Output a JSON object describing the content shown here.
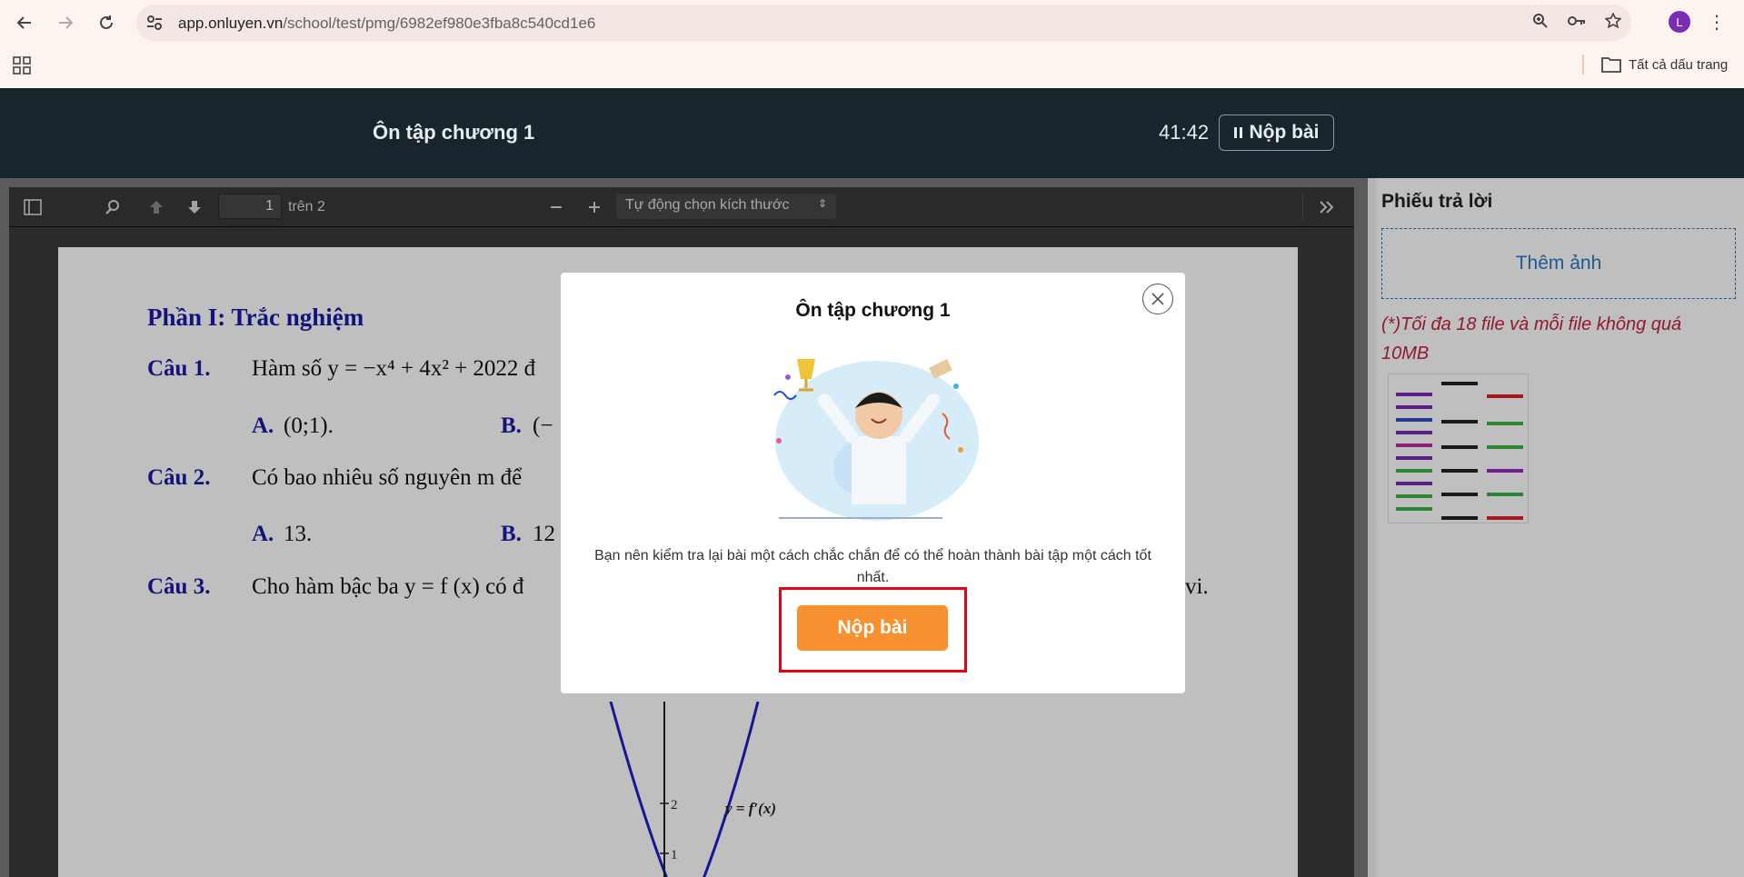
{
  "browser": {
    "url_host": "app.onluyen.vn",
    "url_path": "/school/test/pmg/6982ef980e3fba8c540cd1e6",
    "avatar_letter": "L",
    "bookmarks_all_label": "Tất cả dấu trang",
    "avatar_color": "#7b2bb5"
  },
  "header": {
    "title": "Ôn tập chương 1",
    "timer": "41:42",
    "submit_label": "Nộp bài"
  },
  "pdf_toolbar": {
    "page_number": "1",
    "page_total": "trên 2",
    "zoom_label": "Tự động chọn kích thước"
  },
  "pdf_content": {
    "part_title": "Phần I: Trắc nghiệm",
    "q1_label": "Câu 1.",
    "q1_text": "Hàm số  y = −x⁴ + 4x² + 2022  đ",
    "q1_opt_a_label": "A.",
    "q1_opt_a_text": "(0;1).",
    "q1_opt_b_label": "B.",
    "q1_opt_b_text": "(−",
    "q2_label": "Câu 2.",
    "q2_text": "Có bao nhiêu số nguyên  m  để",
    "q2_opt_a_label": "A.",
    "q2_opt_a_text": "13.",
    "q2_opt_b_label": "B.",
    "q2_opt_b_text": "12",
    "q3_label": "Câu 3.",
    "q3_text": "Cho hàm bậc ba  y = f (x)  có đ",
    "q3_tail": "vi.",
    "graph_label": "y = f′(x)",
    "graph_tick_2": "2",
    "graph_tick_1": "1"
  },
  "right_panel": {
    "title": "Phiếu trả lời",
    "add_photo_label": "Thêm ảnh",
    "limit_note": "(*)Tối đa 18 file và mỗi file không quá 10MB"
  },
  "modal": {
    "title": "Ôn tập chương 1",
    "message": "Bạn nên kiểm tra lại bài một cách chắc chắn để có thể hoàn thành bài tập một cách tốt nhất.",
    "submit_label": "Nộp bài",
    "accent_color": "#f7902e",
    "highlight_color": "#e60012"
  }
}
